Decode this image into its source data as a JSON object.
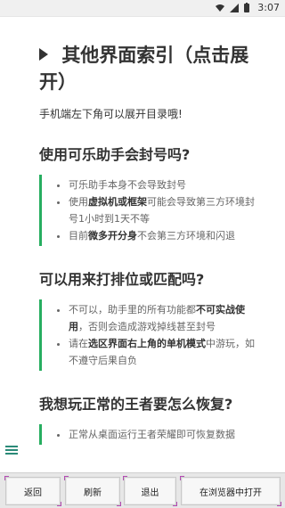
{
  "statusbar": {
    "time": "3:07"
  },
  "page": {
    "title": "其他界面索引（点击展开）",
    "hint": "手机端左下角可以展开目录哦!",
    "sections": [
      {
        "heading": "使用可乐助手会封号吗?",
        "items": [
          "可乐助手本身不会导致封号",
          "使用虚拟机或框架可能会导致第三方环境封号1小时到1天不等",
          "目前微多开分身不会第三方环境和闪退"
        ],
        "bold": [
          "虚拟机或框架",
          "微多开分身"
        ]
      },
      {
        "heading": "可以用来打排位或匹配吗?",
        "items": [
          "不可以，助手里的所有功能都不可实战使用，否则会造成游戏掉线甚至封号",
          "请在选区界面右上角的单机模式中游玩，如不遵守后果自负"
        ],
        "bold": [
          "不可实战使用",
          "选区界面右上角的单机模式"
        ]
      },
      {
        "heading": "我想玩正常的王者要怎么恢复?",
        "items": [
          "正常从桌面运行王者荣耀即可恢复数据"
        ]
      }
    ]
  },
  "bottom_bar": {
    "back": "返回",
    "refresh": "刷新",
    "exit": "退出",
    "open_browser": "在浏览器中打开"
  },
  "colors": {
    "accent": "#27ae60",
    "menu": "#2b8a78",
    "corner": "#b44bb3"
  }
}
